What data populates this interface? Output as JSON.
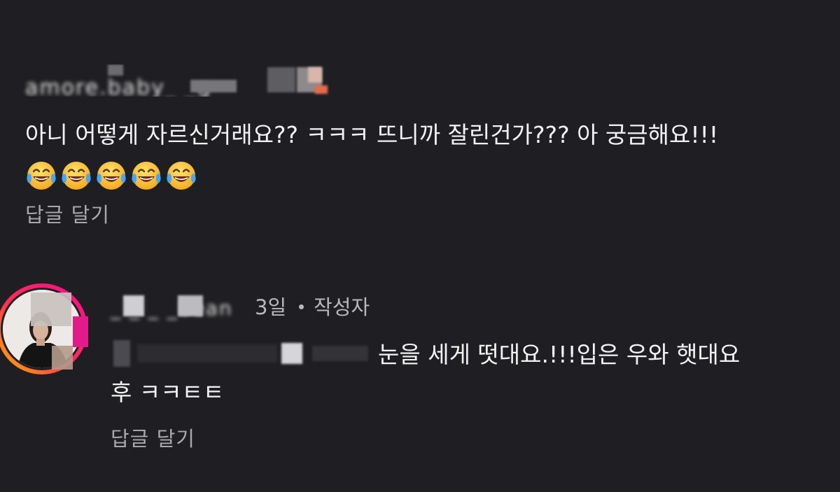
{
  "comments": [
    {
      "username": "amore.baby_ _g",
      "text": "아니 어떻게 자르신거래요?? ㅋㅋㅋ 뜨니까 잘린건가??? 아 궁금해요!!!",
      "emojis": [
        "face-with-tears-of-joy-icon",
        "face-with-tears-of-joy-icon",
        "face-with-tears-of-joy-icon",
        "face-with-tears-of-joy-icon",
        "face-with-tears-of-joy-icon"
      ],
      "reply_label": "답글 달기"
    },
    {
      "username": "_ _ _ _bean",
      "time": "3일",
      "author_badge": "작성자",
      "text_line1": "눈을 세게 떳대요.!!!입은 우와 햇대요",
      "text_line2": "후 ㅋㅋㅌㅌ",
      "reply_label": "답글 달기"
    }
  ],
  "colors": {
    "background": "#1f1f23",
    "text": "#f3f3f3",
    "muted": "#a9a9ad",
    "story_ring_start": "#ff0a8c",
    "story_ring_end": "#ffb300"
  }
}
